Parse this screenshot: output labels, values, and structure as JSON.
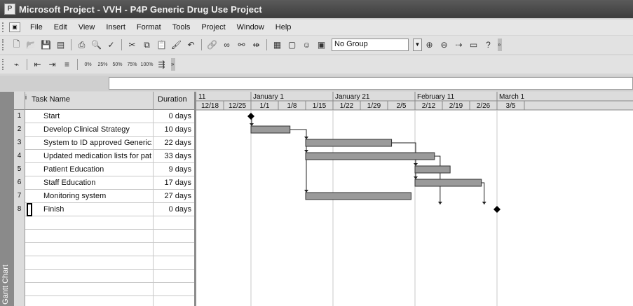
{
  "window": {
    "title": "Microsoft Project - VVH - P4P Generic Drug Use Project"
  },
  "menu": [
    "File",
    "Edit",
    "View",
    "Insert",
    "Format",
    "Tools",
    "Project",
    "Window",
    "Help"
  ],
  "toolbar": {
    "group_value": "No Group",
    "percent_buttons": [
      "0%",
      "25%",
      "50%",
      "75%",
      "100%"
    ]
  },
  "view_bar": {
    "label": "Gantt Chart"
  },
  "table": {
    "headers": {
      "indicator": "i",
      "name": "Task Name",
      "duration": "Duration"
    },
    "rows": [
      {
        "id": "1",
        "name": "Start",
        "duration": "0 days"
      },
      {
        "id": "2",
        "name": "Develop Clinical Strategy",
        "duration": "10 days"
      },
      {
        "id": "3",
        "name": "System to ID approved Generic:",
        "duration": "22 days"
      },
      {
        "id": "4",
        "name": "Updated medication lists for pat",
        "duration": "33 days"
      },
      {
        "id": "5",
        "name": "Patient Education",
        "duration": "9 days"
      },
      {
        "id": "6",
        "name": "Staff Education",
        "duration": "17 days"
      },
      {
        "id": "7",
        "name": "Monitoring system",
        "duration": "27 days"
      },
      {
        "id": "8",
        "name": "Finish",
        "duration": "0 days"
      }
    ]
  },
  "timescale": {
    "major": [
      "11",
      "January 1",
      "January 21",
      "February 11",
      "March 1"
    ],
    "minor": [
      "12/18",
      "12/25",
      "1/1",
      "1/8",
      "1/15",
      "1/22",
      "1/29",
      "2/5",
      "2/12",
      "2/19",
      "2/26",
      "3/5"
    ]
  },
  "gantt": {
    "milestones": [
      {
        "task": "1",
        "date": "1/1"
      },
      {
        "task": "8",
        "date": "3/5"
      }
    ],
    "bars": [
      {
        "task": "2",
        "start": "1/1",
        "duration_days": 10
      },
      {
        "task": "3",
        "start": "1/15",
        "duration_days": 22
      },
      {
        "task": "4",
        "start": "1/15",
        "duration_days": 33
      },
      {
        "task": "5",
        "start": "2/12",
        "duration_days": 9
      },
      {
        "task": "6",
        "start": "2/12",
        "duration_days": 17
      },
      {
        "task": "7",
        "start": "1/15",
        "duration_days": 27
      }
    ]
  }
}
